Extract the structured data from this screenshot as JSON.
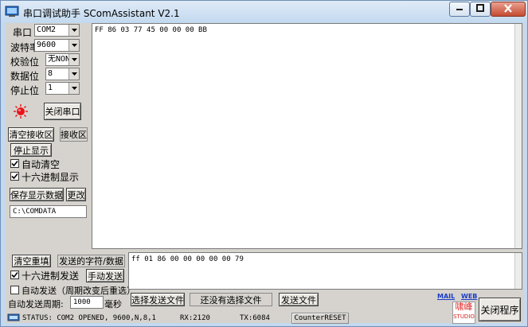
{
  "window": {
    "title": "串口调试助手 SComAssistant V2.1",
    "title_icon": "serial-port-icon",
    "controls": [
      "minimize-icon",
      "maximize-icon",
      "close-icon"
    ]
  },
  "settings": {
    "port_label": "串口",
    "port_value": "COM2",
    "baud_label": "波特率",
    "baud_value": "9600",
    "parity_label": "校验位",
    "parity_value": "无NONE",
    "databits_label": "数据位",
    "databits_value": "8",
    "stopbits_label": "停止位",
    "stopbits_value": "1"
  },
  "port_status_indicator": {
    "icon": "red-indicator-icon",
    "color": "#e8141a"
  },
  "buttons": {
    "close_port": "关闭串口",
    "clear_receive": "清空接收区",
    "receive_area": "接收区",
    "stop_display": "停止显示",
    "save_data": "保存显示数据",
    "change": "更改",
    "clear_resend": "清空重填",
    "sent_chars": "发送的字符/数据",
    "manual_send": "手动发送",
    "select_file": "选择发送文件",
    "no_file": "还没有选择文件",
    "send_file": "发送文件",
    "close_program": "关闭程序"
  },
  "checkboxes": {
    "auto_clear": {
      "label": "自动清空",
      "checked": true
    },
    "hex_display": {
      "label": "十六进制显示",
      "checked": true
    },
    "hex_send": {
      "label": "十六进制发送",
      "checked": true
    },
    "auto_send": {
      "label": "自动发送（周期改变后重选）",
      "checked": false
    }
  },
  "save_path": "C:\\COMDATA",
  "receive_text": "FF 86 03 77 45 00 00 00 BB",
  "send_text": "ff 01 86 00 00 00 00 00 79",
  "auto_period": {
    "label": "自动发送周期:",
    "value": "1000",
    "unit": "毫秒"
  },
  "links": {
    "mail": "MAIL",
    "web": "WEB"
  },
  "logo": {
    "text": "啸峰",
    "sub": "STUDIO"
  },
  "statusbar": {
    "status": "STATUS: COM2 OPENED, 9600,N,8,1",
    "rx": "RX:2120",
    "tx": "TX:6084",
    "counter_reset": "CounterRESET"
  }
}
